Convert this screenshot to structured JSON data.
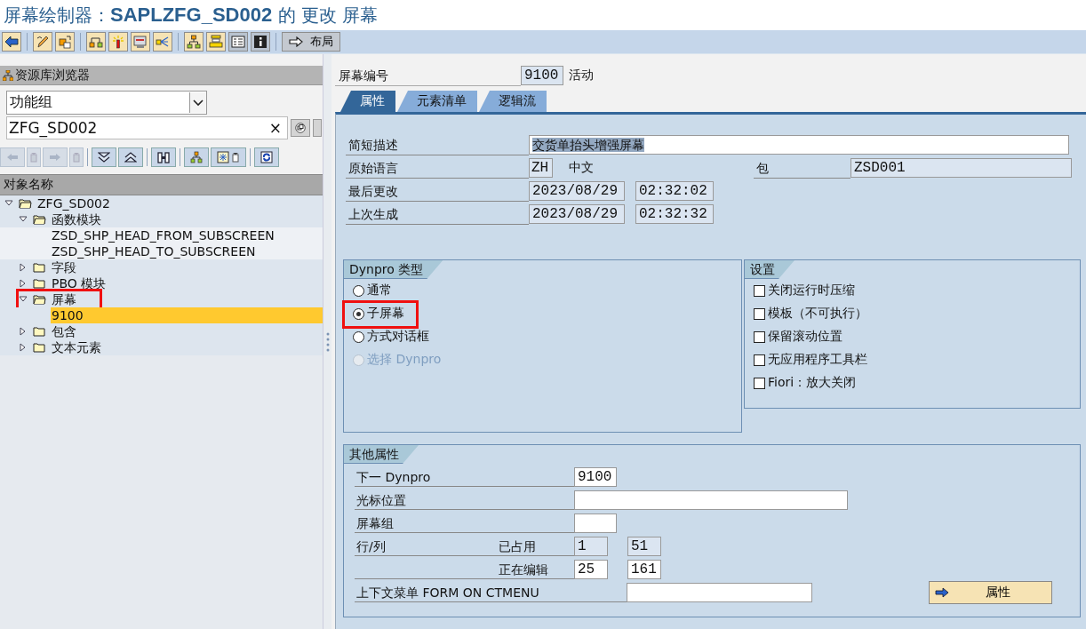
{
  "window": {
    "title": "屏幕绘制器：**SAPLZFG_SD002** 的 更改 屏幕"
  },
  "toolbar": {
    "layout_button": "布局"
  },
  "repository_browser": {
    "title": "资源库浏览器",
    "object_type": "功能组",
    "object_name": "ZFG_SD002",
    "clear": "×",
    "column_header": "对象名称",
    "tree": [
      {
        "label": "ZFG_SD002",
        "expanded": true,
        "selected": false,
        "annotated": false,
        "children": [
          {
            "label": "函数模块",
            "expanded": true,
            "selected": false,
            "annotated": false,
            "children": [
              {
                "label": "ZSD_SHP_HEAD_FROM_SUBSCREEN",
                "selected": false,
                "annotated": false
              },
              {
                "label": "ZSD_SHP_HEAD_TO_SUBSCREEN",
                "selected": false,
                "annotated": false
              }
            ]
          },
          {
            "label": "字段",
            "expanded": false,
            "selected": false,
            "annotated": false
          },
          {
            "label": "PBO 模块",
            "expanded": false,
            "selected": false,
            "annotated": false
          },
          {
            "label": "屏幕",
            "expanded": true,
            "selected": false,
            "annotated": true,
            "children": [
              {
                "label": "9100",
                "selected": true,
                "annotated": false
              }
            ]
          },
          {
            "label": "包含",
            "expanded": false,
            "selected": false,
            "annotated": false
          },
          {
            "label": "文本元素",
            "expanded": false,
            "selected": false,
            "annotated": false
          }
        ]
      }
    ]
  },
  "screen_number": {
    "label": "屏幕编号",
    "value": "9100",
    "status": "活动"
  },
  "tabs": [
    {
      "label": "属性",
      "selected": true
    },
    {
      "label": "元素清单",
      "selected": false
    },
    {
      "label": "逻辑流",
      "selected": false
    }
  ],
  "attributes": {
    "short_description": {
      "label": "简短描述",
      "value": "交货单抬头增强屏幕"
    },
    "original_language": {
      "label": "原始语言",
      "code": "ZH",
      "name": "中文"
    },
    "package": {
      "label": "包",
      "value": "ZSD001"
    },
    "last_changed": {
      "label": "最后更改",
      "date": "2023/08/29",
      "time": "02:32:02"
    },
    "last_generated": {
      "label": "上次生成",
      "date": "2023/08/29",
      "time": "02:32:32"
    }
  },
  "dynpro_type": {
    "title": "Dynpro 类型",
    "options": [
      {
        "label": "通常",
        "selected": false,
        "disabled": false,
        "annotated": false
      },
      {
        "label": "子屏幕",
        "selected": true,
        "disabled": false,
        "annotated": true
      },
      {
        "label": "方式对话框",
        "selected": false,
        "disabled": false,
        "annotated": false
      },
      {
        "label": "选择 Dynpro",
        "selected": false,
        "disabled": true,
        "annotated": false
      }
    ]
  },
  "settings": {
    "title": "设置",
    "options": [
      {
        "label": "关闭运行时压缩",
        "checked": false
      },
      {
        "label": "模板（不可执行）",
        "checked": false
      },
      {
        "label": "保留滚动位置",
        "checked": false
      },
      {
        "label": "无应用程序工具栏",
        "checked": false
      },
      {
        "label": "Fiori：放大关闭",
        "checked": false
      }
    ]
  },
  "other_attributes": {
    "title": "其他属性",
    "next_dynpro": {
      "label": "下一 Dynpro",
      "value": "9100"
    },
    "cursor_position": {
      "label": "光标位置"
    },
    "screen_group": {
      "label": "屏幕组"
    },
    "lines_columns": {
      "label": "行/列",
      "used_label": "已占用",
      "used_lines": "1",
      "used_columns": "51",
      "editing_label": "正在编辑",
      "editing_lines": "25",
      "editing_columns": "161"
    },
    "context_menu": {
      "label": "上下文菜单 FORM ON CTMENU"
    },
    "button": "属性"
  }
}
